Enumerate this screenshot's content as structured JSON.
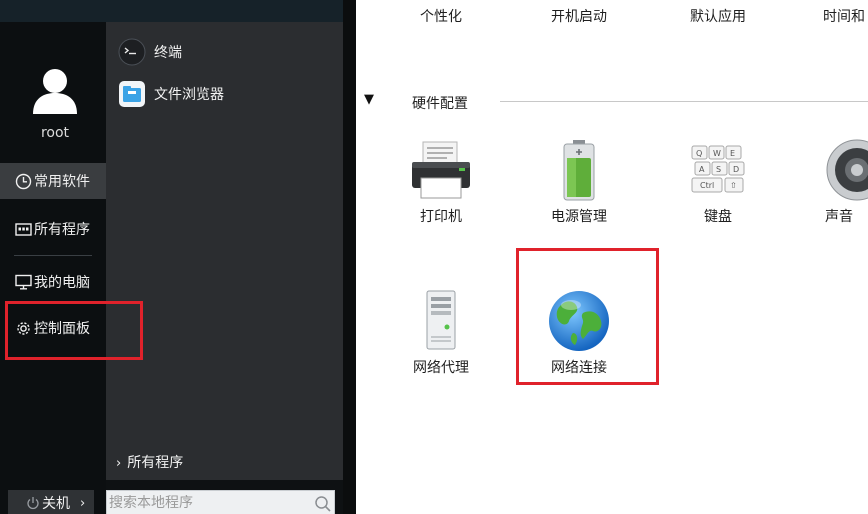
{
  "start_menu": {
    "user": {
      "name": "root"
    },
    "sidebar": {
      "items": [
        {
          "label": "常用软件",
          "icon": "clock-icon",
          "selected": true
        },
        {
          "label": "所有程序",
          "icon": "app-grid-icon",
          "selected": false
        },
        {
          "label": "我的电脑",
          "icon": "monitor-icon",
          "selected": false
        },
        {
          "label": "控制面板",
          "icon": "gear-icon",
          "selected": false
        }
      ]
    },
    "apps": [
      {
        "label": "终端",
        "icon": "terminal-icon"
      },
      {
        "label": "文件浏览器",
        "icon": "file-browser-icon"
      }
    ],
    "all_programs_label": "所有程序",
    "power": {
      "label": "关机",
      "icon": "power-icon"
    },
    "search": {
      "placeholder": "搜索本地程序",
      "value": ""
    }
  },
  "control_panel": {
    "top_row": [
      {
        "label": "个性化"
      },
      {
        "label": "开机启动"
      },
      {
        "label": "默认应用"
      },
      {
        "label": "时间和"
      }
    ],
    "section": {
      "title": "硬件配置",
      "expanded": true
    },
    "hardware_items": [
      {
        "label": "打印机",
        "icon": "printer-icon"
      },
      {
        "label": "电源管理",
        "icon": "battery-icon"
      },
      {
        "label": "键盘",
        "icon": "keyboard-icon"
      },
      {
        "label": "声音",
        "icon": "speaker-icon"
      },
      {
        "label": "网络代理",
        "icon": "server-icon"
      },
      {
        "label": "网络连接",
        "icon": "globe-icon"
      }
    ]
  },
  "colors": {
    "highlight": "#e0222b",
    "menu_dark": "#0e1113",
    "menu_panel": "#2b2d30",
    "menu_selected": "#3a3d40"
  }
}
